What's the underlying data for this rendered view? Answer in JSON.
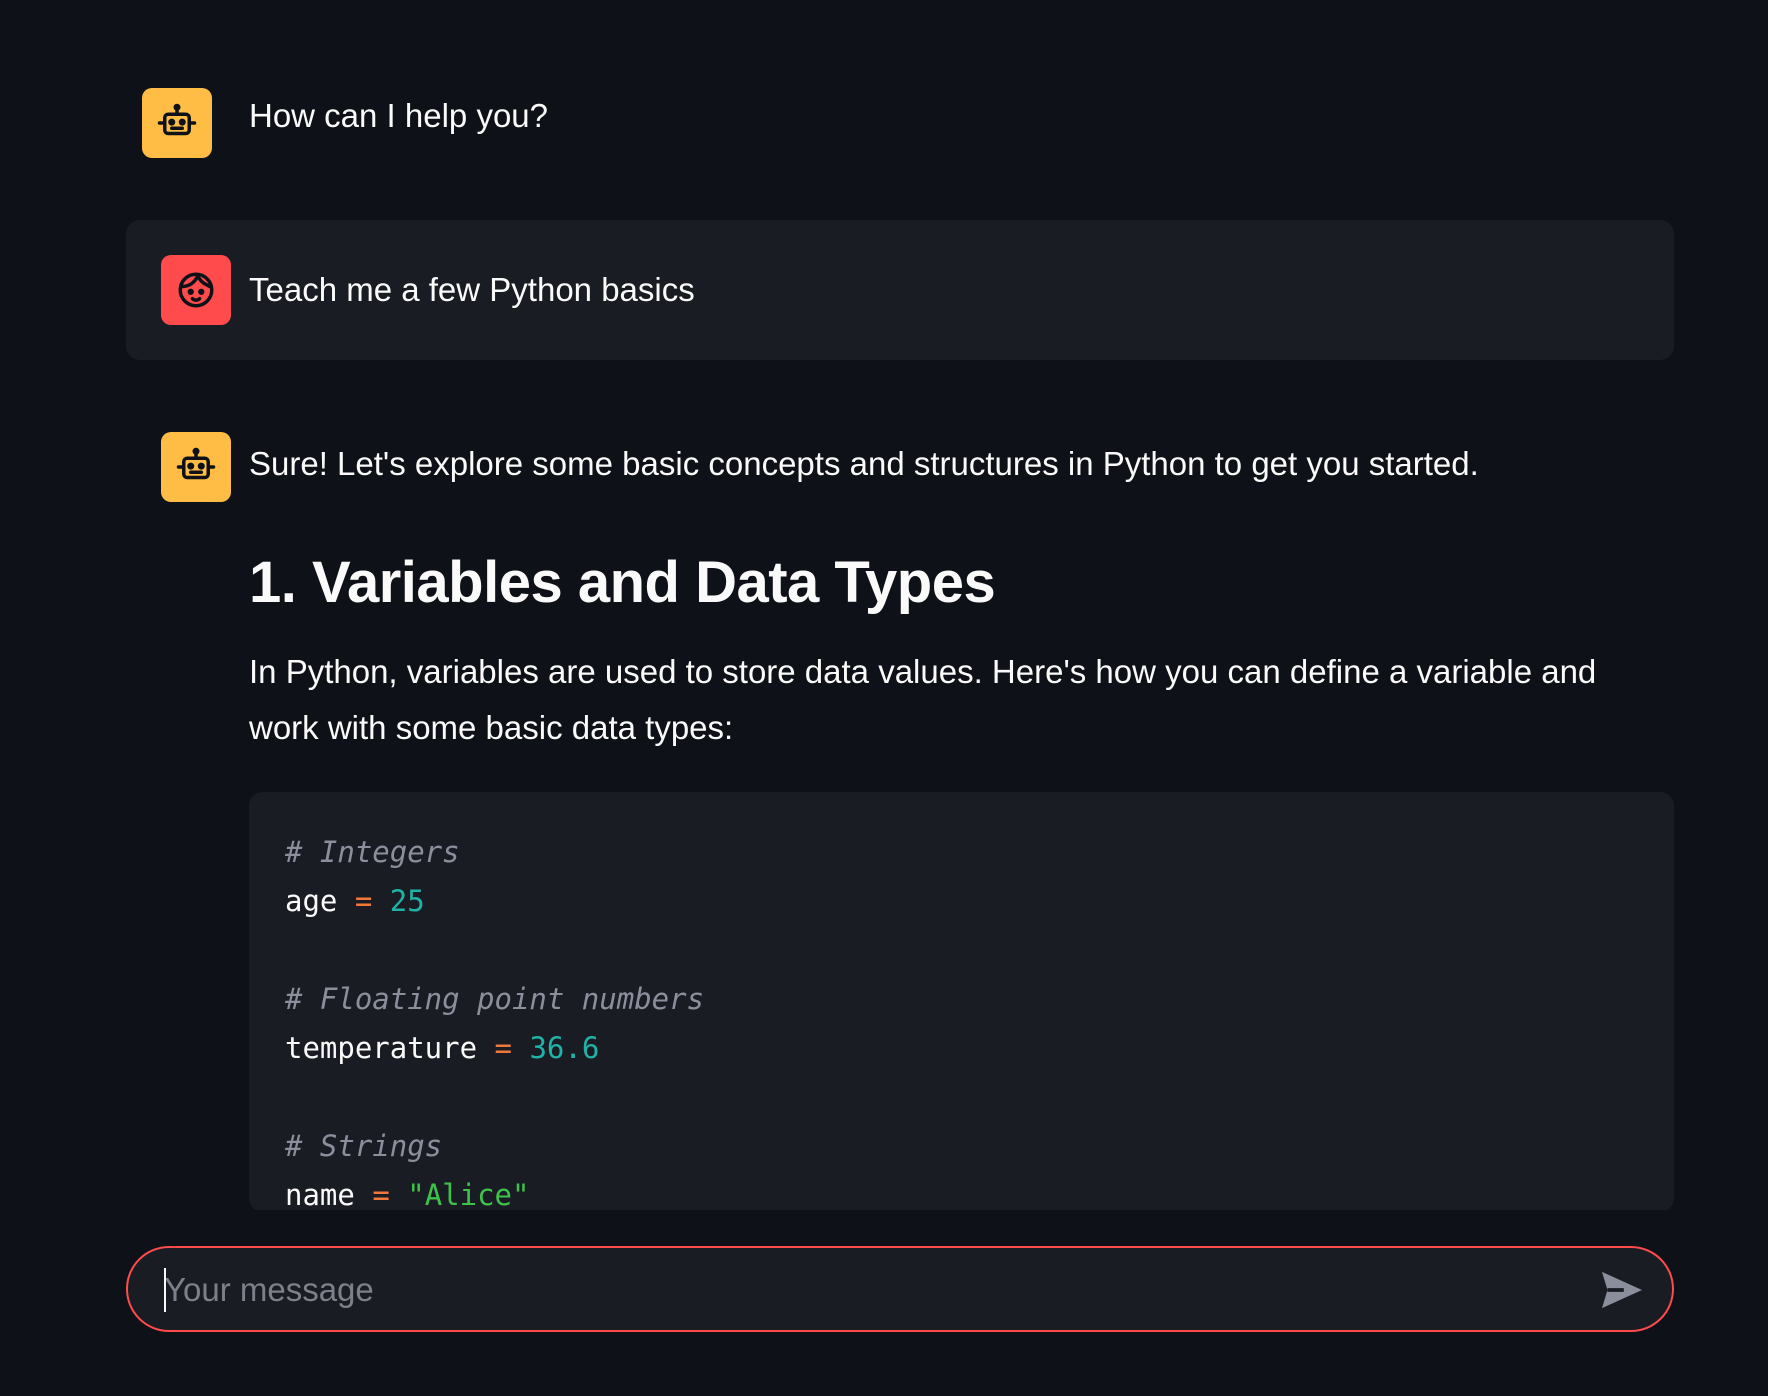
{
  "messages": [
    {
      "role": "assistant",
      "avatar_icon": "robot-icon",
      "text": "How can I help you?"
    },
    {
      "role": "user",
      "avatar_icon": "face-icon",
      "text": "Teach me a few Python basics"
    },
    {
      "role": "assistant",
      "avatar_icon": "robot-icon",
      "text": "Sure! Let's explore some basic concepts and structures in Python to get you started."
    }
  ],
  "section": {
    "heading": "1. Variables and Data Types",
    "paragraph": "In Python, variables are used to store data values. Here's how you can define a variable and work with some basic data types:"
  },
  "code": {
    "comment_integers": "# Integers",
    "var_age": "age",
    "val_age": "25",
    "comment_floats": "# Floating point numbers",
    "var_temperature": "temperature",
    "val_temperature": "36.6",
    "comment_strings": "# Strings",
    "var_name": "name",
    "val_name": "\"Alice\"",
    "assign_op": "="
  },
  "chat_input": {
    "placeholder": "Your message",
    "value": ""
  },
  "colors": {
    "background": "#0e1117",
    "message_bg": "#1a1c24",
    "bot_avatar": "#ffbd45",
    "user_avatar": "#ff4b4b",
    "input_border": "#ff4b4b"
  }
}
